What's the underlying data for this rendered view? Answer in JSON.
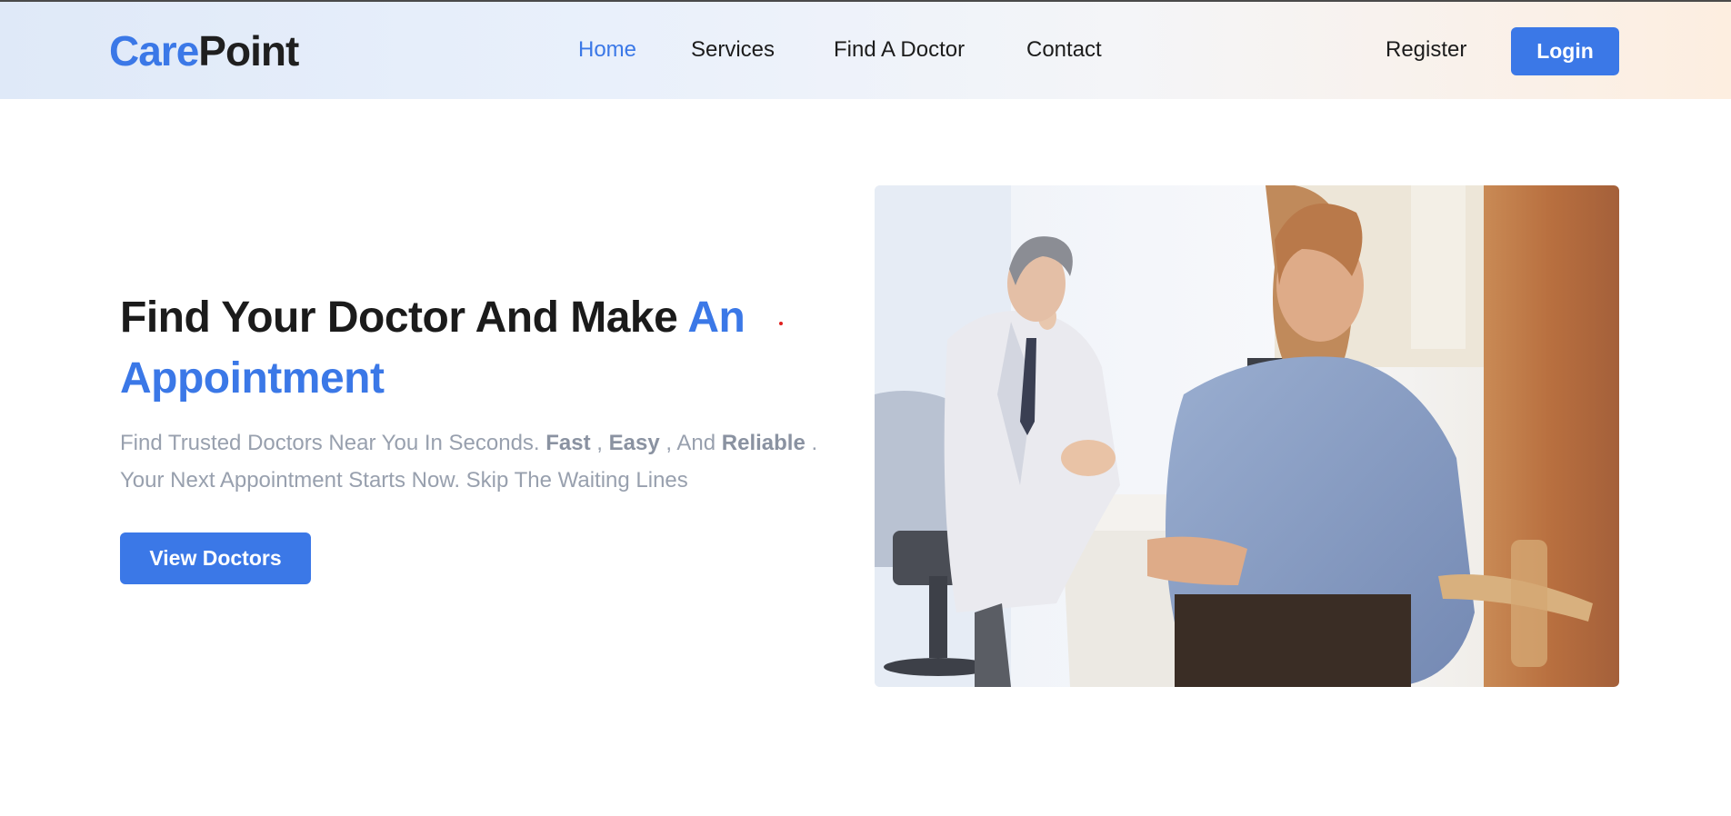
{
  "brand": {
    "part1": "Care",
    "part2": "Point"
  },
  "nav": {
    "items": [
      {
        "label": "Home",
        "active": true
      },
      {
        "label": "Services",
        "active": false
      },
      {
        "label": "Find A Doctor",
        "active": false
      },
      {
        "label": "Contact",
        "active": false
      }
    ],
    "register_label": "Register",
    "login_label": "Login"
  },
  "hero": {
    "title_main": "Find Your Doctor And Make ",
    "title_accent_1": "An",
    "title_accent_2": "Appointment",
    "sub_1": "Find Trusted Doctors Near You In Seconds. ",
    "sub_fast": "Fast",
    "sub_sep_1": " , ",
    "sub_easy": "Easy",
    "sub_sep_2": " , And ",
    "sub_reliable": "Reliable",
    "sub_end": " .",
    "sub_2": "Your Next Appointment Starts Now. Skip The Waiting Lines",
    "cta_label": "View Doctors"
  },
  "colors": {
    "accent": "#3b78e7",
    "text_dark": "#1b1b1b",
    "text_muted": "#98a0ae",
    "header_gradient_start": "#dfe9f8",
    "header_gradient_end": "#fdeee0"
  },
  "icons": {
    "hero_image": "doctor-consultation-photo"
  }
}
